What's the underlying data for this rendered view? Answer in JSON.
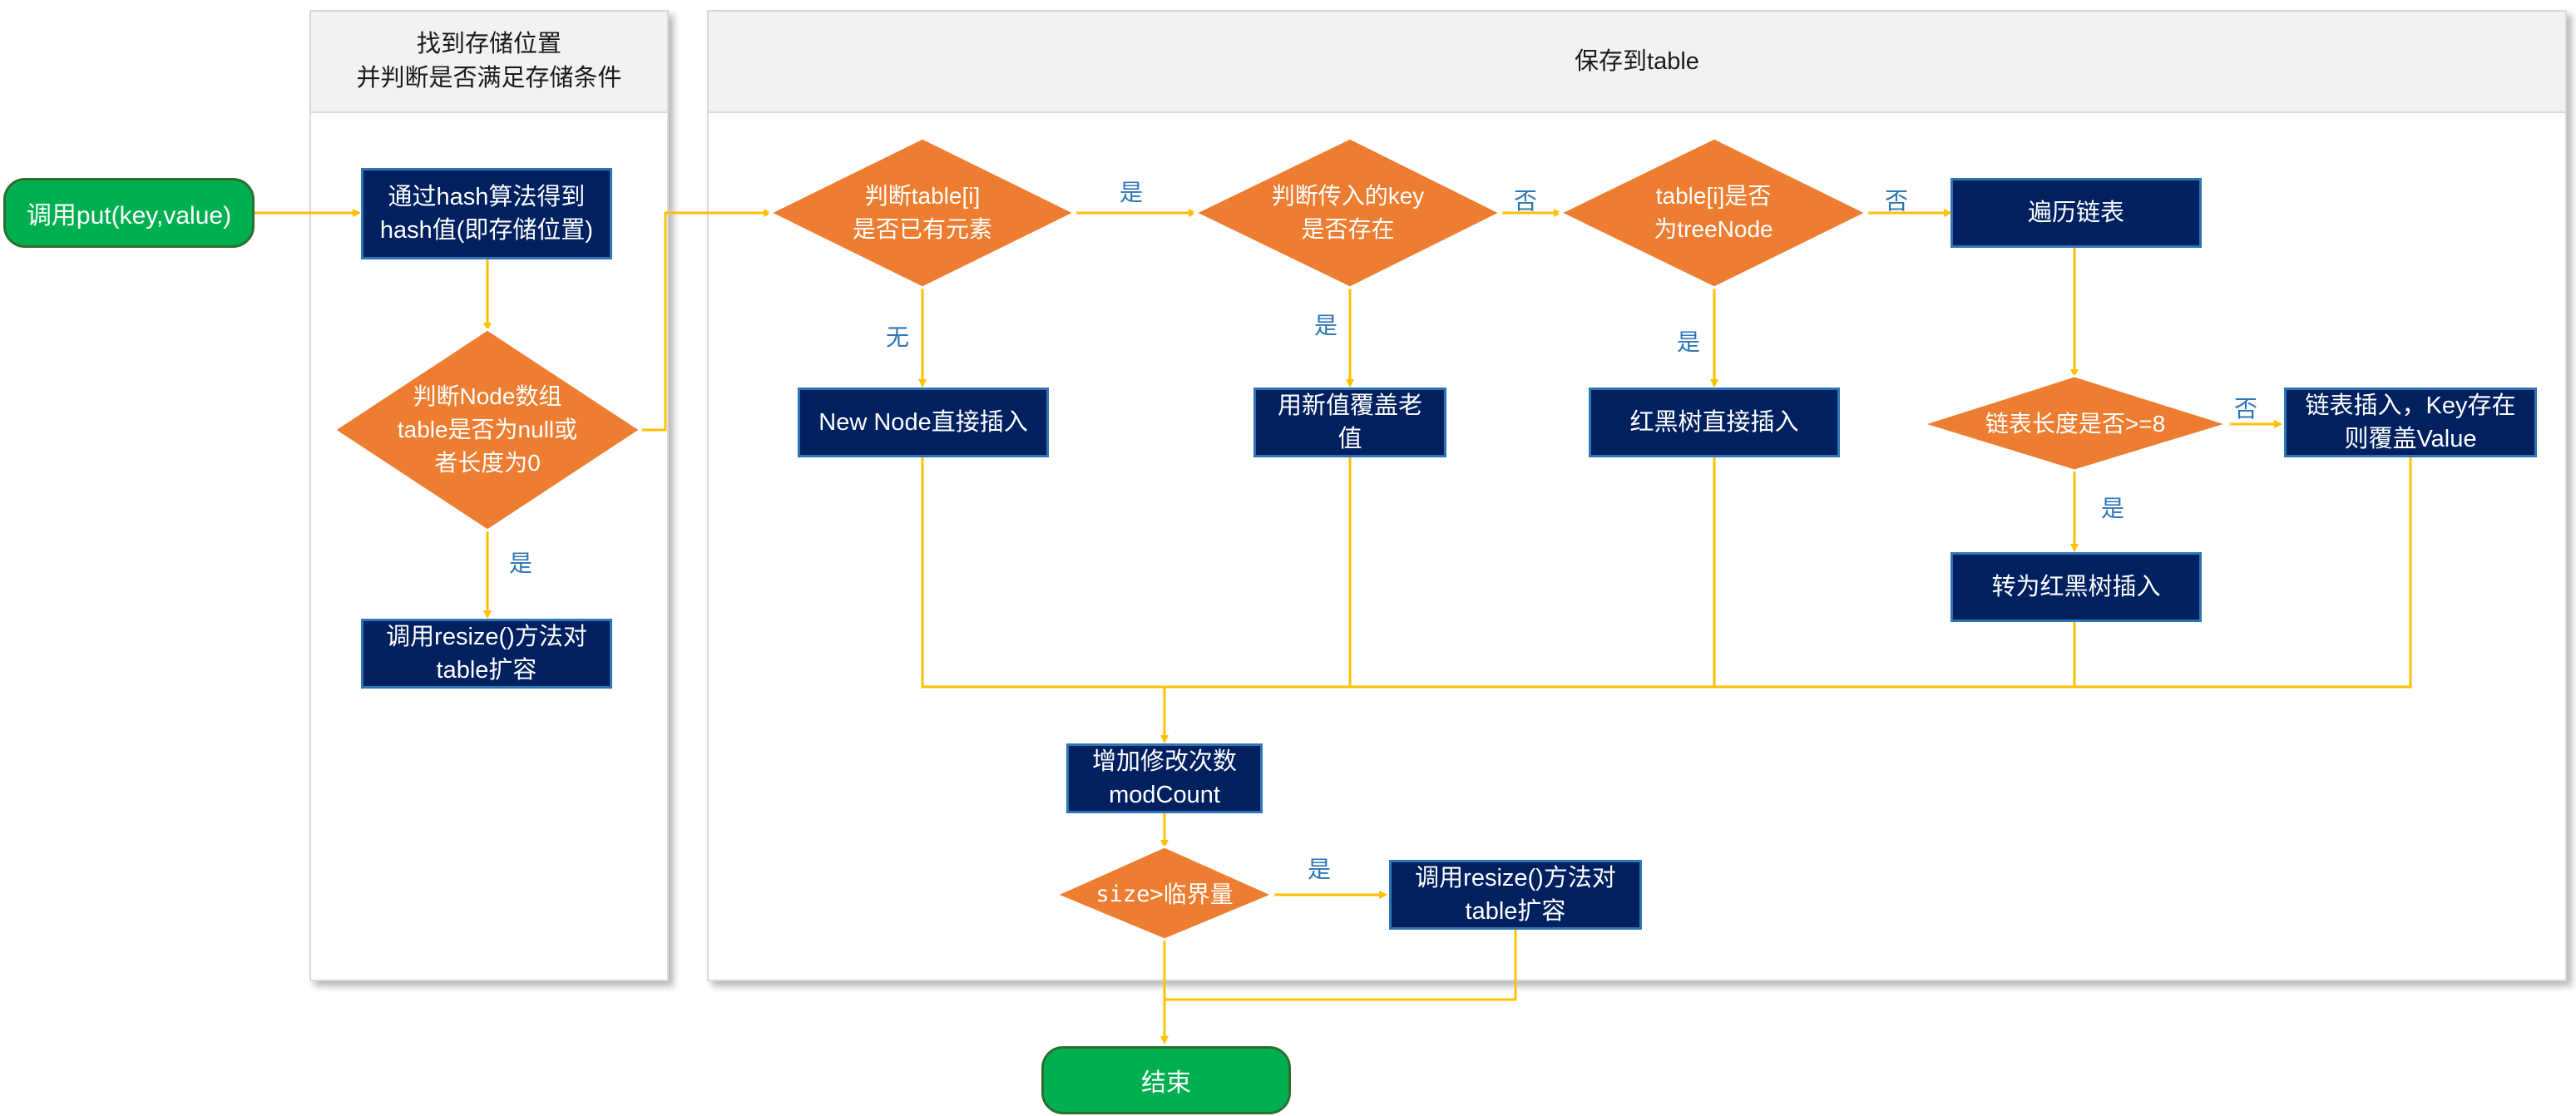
{
  "lanes": {
    "left_line1": "找到存储位置",
    "left_line2": "并判断是否满足存储条件",
    "right_title": "保存到table"
  },
  "nodes": {
    "start": "调用put(key,value)",
    "hash_l1": "通过hash算法得到",
    "hash_l2": "hash值(即存储位置)",
    "check_l1": "判断Node数组",
    "check_l2": "table是否为null或",
    "check_l3": "者长度为0",
    "resize1_l1": "调用resize()方法对",
    "resize1_l2": "table扩容",
    "has_l1": "判断table[i]",
    "has_l2": "是否已有元素",
    "newnode": "New Node直接插入",
    "keyexist_l1": "判断传入的key",
    "keyexist_l2": "是否存在",
    "overwrite_l1": "用新值覆盖老",
    "overwrite_l2": "值",
    "istree_l1": "table[i]是否",
    "istree_l2": "为treeNode",
    "rbinsert": "红黑树直接插入",
    "traverse": "遍历链表",
    "lenchk": "链表长度是否>=8",
    "listins_l1": "链表插入，Key存在",
    "listins_l2": "则覆盖Value",
    "torb": "转为红黑树插入",
    "modcount_l1": "增加修改次数",
    "modcount_l2": "modCount",
    "size_a": "size>",
    "size_b": "临界量",
    "resize2_l1": "调用resize()方法对",
    "resize2_l2": "table扩容",
    "end": "结束"
  },
  "edge_labels": {
    "yes": "是",
    "no": "否",
    "none": "无"
  },
  "colors": {
    "process": "#002060",
    "process_border": "#2e75b6",
    "decision": "#ed7d31",
    "terminal": "#00b050",
    "connector": "#ffc000",
    "edge_label": "#2e75b6"
  }
}
